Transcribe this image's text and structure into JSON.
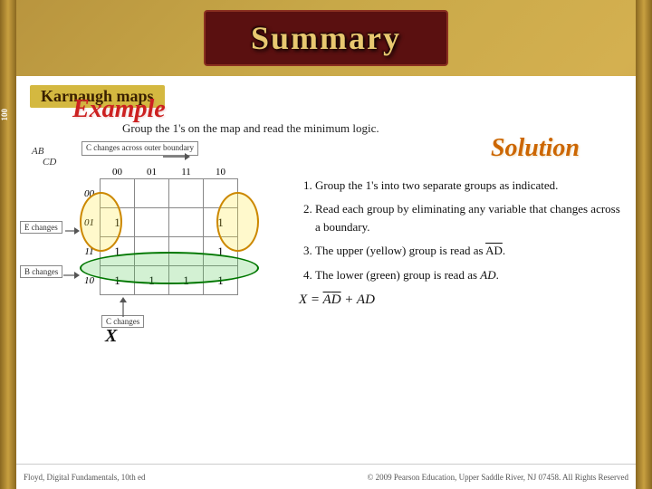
{
  "header": {
    "title": "Summary",
    "background_color": "#5a1010"
  },
  "karnaugh_label": "Karnaugh maps",
  "example_heading": "Example",
  "solution_heading": "Solution",
  "instruction": "Group the 1's on the map and read the minimum logic.",
  "labels": {
    "c_changes_outer": "C changes across\nouter boundary",
    "e_changes": "E changes",
    "b_changes": "B changes",
    "c_changes_bottom": "C changes",
    "x_variable": "X"
  },
  "kmap": {
    "col_headers": [
      "00",
      "01",
      "11",
      "10"
    ],
    "row_headers": [
      "00",
      "01",
      "11",
      "10"
    ],
    "ab_label": "AB",
    "cd_label": "CD",
    "cells": [
      [
        null,
        null,
        null,
        null
      ],
      [
        "1",
        null,
        null,
        "1"
      ],
      [
        "1",
        null,
        null,
        "1"
      ],
      [
        "1",
        "1",
        "1",
        "1"
      ]
    ]
  },
  "solution_steps": [
    "Group the 1's into two separate groups as indicated.",
    "Read each group by eliminating any variable that changes across a boundary.",
    "The upper (yellow) group is read as AD̄.",
    "The lower (green) group is read as AD."
  ],
  "formula": "X = ĀD̄ +AD",
  "footer": {
    "left": "Floyd, Digital Fundamentals, 10th ed",
    "right": "© 2009 Pearson Education, Upper Saddle River, NJ 07458. All Rights Reserved"
  }
}
